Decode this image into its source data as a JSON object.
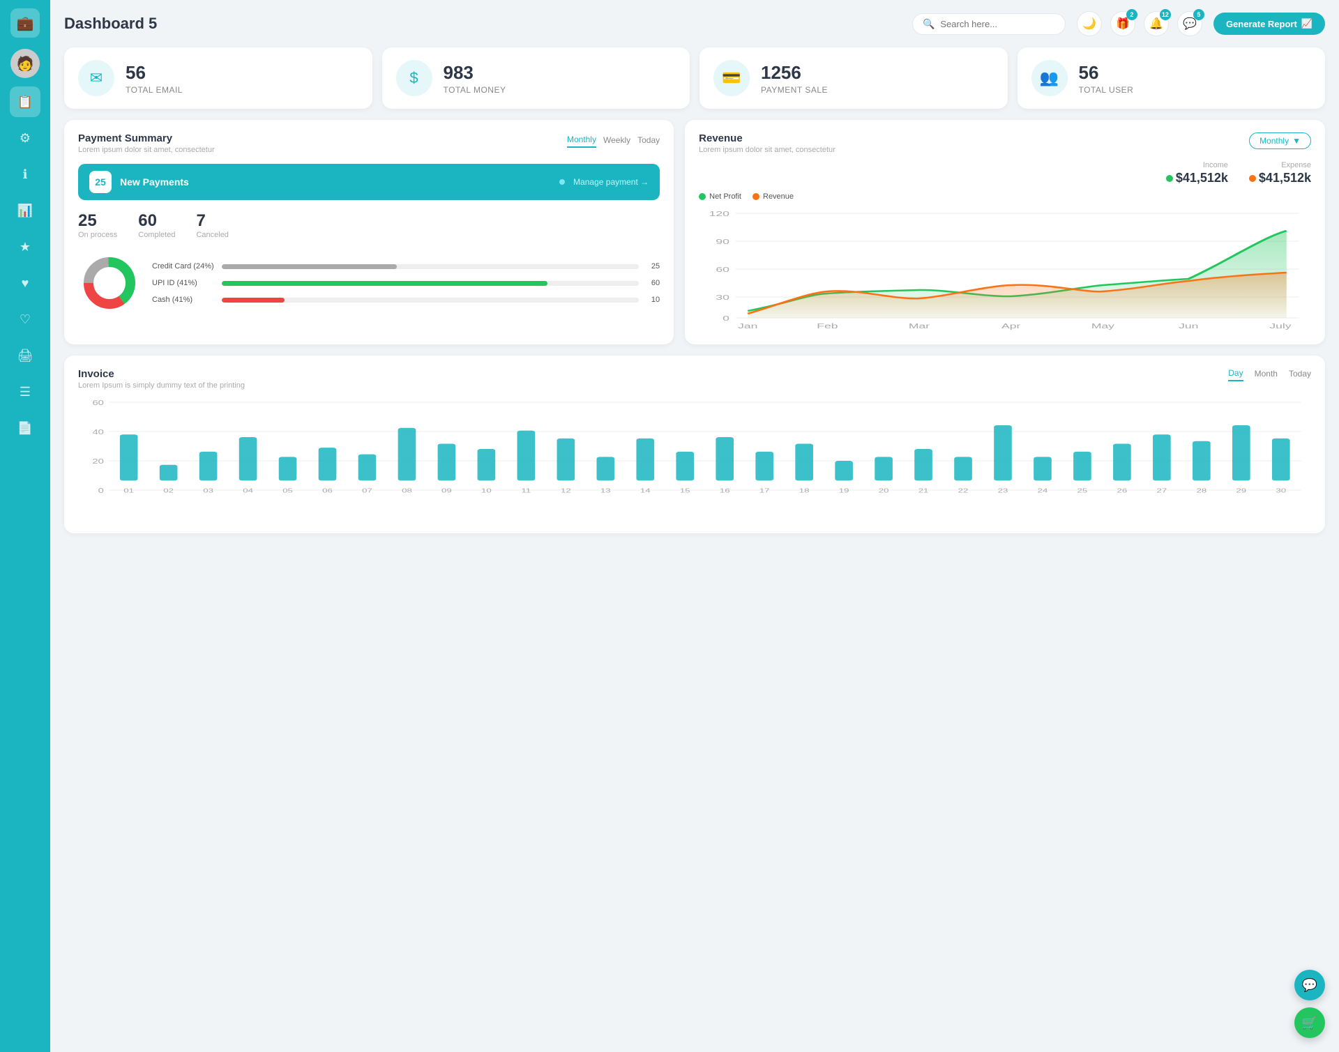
{
  "app": {
    "title": "Dashboard 5"
  },
  "header": {
    "search_placeholder": "Search here...",
    "generate_btn": "Generate Report",
    "badges": {
      "gift": "2",
      "bell": "12",
      "chat": "5"
    }
  },
  "stats": [
    {
      "id": "email",
      "number": "56",
      "label": "TOTAL EMAIL",
      "icon": "✉"
    },
    {
      "id": "money",
      "number": "983",
      "label": "TOTAL MONEY",
      "icon": "$"
    },
    {
      "id": "payment",
      "number": "1256",
      "label": "PAYMENT SALE",
      "icon": "💳"
    },
    {
      "id": "user",
      "number": "56",
      "label": "TOTAL USER",
      "icon": "👥"
    }
  ],
  "payment_summary": {
    "title": "Payment Summary",
    "subtitle": "Lorem ipsum dolor sit amet, consectetur",
    "tabs": [
      "Monthly",
      "Weekly",
      "Today"
    ],
    "active_tab": "Monthly",
    "new_payments_count": "25",
    "new_payments_label": "New Payments",
    "manage_link": "Manage payment",
    "stats": [
      {
        "num": "25",
        "label": "On process"
      },
      {
        "num": "60",
        "label": "Completed"
      },
      {
        "num": "7",
        "label": "Canceled"
      }
    ],
    "progress_items": [
      {
        "label": "Credit Card (24%)",
        "color": "#aaa",
        "pct": 42,
        "value": "25"
      },
      {
        "label": "UPI ID (41%)",
        "color": "#22c55e",
        "pct": 78,
        "value": "60"
      },
      {
        "label": "Cash (41%)",
        "color": "#ef4444",
        "pct": 15,
        "value": "10"
      }
    ],
    "donut": {
      "segments": [
        {
          "color": "#aaa",
          "pct": 24
        },
        {
          "color": "#22c55e",
          "pct": 41
        },
        {
          "color": "#ef4444",
          "pct": 35
        }
      ]
    }
  },
  "revenue": {
    "title": "Revenue",
    "subtitle": "Lorem ipsum dolor sit amet, consectetur",
    "active_tab": "Monthly",
    "income": {
      "label": "Income",
      "amount": "$41,512k"
    },
    "expense": {
      "label": "Expense",
      "amount": "$41,512k"
    },
    "legend": [
      {
        "label": "Net Profit",
        "color": "#22c55e"
      },
      {
        "label": "Revenue",
        "color": "#f97316"
      }
    ],
    "x_labels": [
      "Jan",
      "Feb",
      "Mar",
      "Apr",
      "May",
      "Jun",
      "July"
    ],
    "y_labels": [
      "0",
      "30",
      "60",
      "90",
      "120"
    ],
    "net_profit_data": [
      8,
      28,
      32,
      25,
      38,
      45,
      100
    ],
    "revenue_data": [
      5,
      30,
      22,
      38,
      30,
      42,
      52
    ]
  },
  "invoice": {
    "title": "Invoice",
    "subtitle": "Lorem Ipsum is simply dummy text of the printing",
    "tabs": [
      "Day",
      "Month",
      "Today"
    ],
    "active_tab": "Day",
    "y_labels": [
      "0",
      "20",
      "40",
      "60"
    ],
    "x_labels": [
      "01",
      "02",
      "03",
      "04",
      "05",
      "06",
      "07",
      "08",
      "09",
      "10",
      "11",
      "12",
      "13",
      "14",
      "15",
      "16",
      "17",
      "18",
      "19",
      "20",
      "21",
      "22",
      "23",
      "24",
      "25",
      "26",
      "27",
      "28",
      "29",
      "30"
    ],
    "bar_data": [
      35,
      12,
      22,
      33,
      18,
      25,
      20,
      40,
      28,
      24,
      38,
      32,
      18,
      32,
      22,
      33,
      22,
      28,
      15,
      18,
      24,
      18,
      42,
      18,
      22,
      28,
      35,
      30,
      42,
      32
    ]
  },
  "sidebar": {
    "items": [
      {
        "icon": "📋",
        "label": "dashboard",
        "active": true
      },
      {
        "icon": "⚙",
        "label": "settings"
      },
      {
        "icon": "ℹ",
        "label": "info"
      },
      {
        "icon": "📊",
        "label": "analytics"
      },
      {
        "icon": "★",
        "label": "favorites"
      },
      {
        "icon": "♥",
        "label": "liked"
      },
      {
        "icon": "♥",
        "label": "saved"
      },
      {
        "icon": "🖨",
        "label": "print"
      },
      {
        "icon": "☰",
        "label": "menu"
      },
      {
        "icon": "📄",
        "label": "documents"
      }
    ]
  },
  "floatbuttons": {
    "support": "💬",
    "cart": "🛒"
  }
}
